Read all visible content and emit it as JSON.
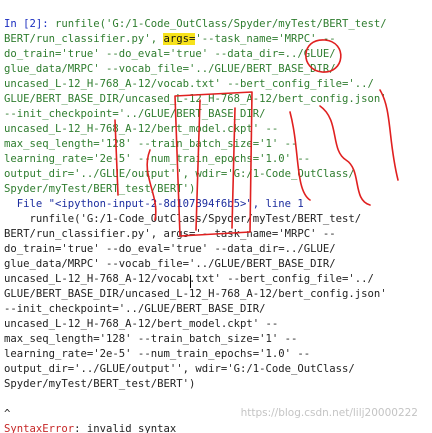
{
  "console": {
    "prompt": "In [2]:",
    "command_lines": [
      " runfile('G:/1-Code_OutClass/Spyder/myTest/BERT_test/",
      "BERT/run_classifier.py', ",
      "args=",
      "'--task_name='MRPC' --",
      "do_train='true' --do_eval='true' --data_dir=../GLUE/",
      "glue_data/MRPC' --vocab_file='../GLUE/BERT_BASE_DIR/",
      "uncased_L-12_H-768_A-12/vocab.txt' --bert_config_file='../",
      "GLUE/BERT_BASE_DIR/uncased_L-12_H-768_A-12/bert_config.json'",
      "--init_checkpoint='../GLUE/BERT_BASE_DIR/",
      "uncased_L-12_H-768_A-12/bert_model.ckpt' --",
      "max_seq_length='128' --train_batch_size='1' --",
      "learning_rate='2e-5' --num_train_epochs='1.0' --",
      "output_dir='../GLUE/output'', wdir='G:/1-Code_OutClass/",
      "Spyder/myTest/BERT_test/BERT')"
    ],
    "traceback_file": "  File \"<ipython-input-2-8d107894f6b5>\", line 1",
    "traceback_lines": [
      "    runfile('G:/1-Code_OutClass/Spyder/myTest/BERT_test/",
      "BERT/run_classifier.py', args='--task_name='MRPC' --",
      "do_train='true' --do_eval='true' --data_dir=../GLUE/",
      "glue_data/MRPC' --vocab_file='../GLUE/BERT_BASE_DIR/",
      "uncased_L-12_H-768_A-12/vocab.txt' --bert_config_file='../",
      "GLUE/BERT_BASE_DIR/uncased_L-12_H-768_A-12/bert_config.json'",
      "--init_checkpoint='../GLUE/BERT_BASE_DIR/",
      "uncased_L-12_H-768_A-12/bert_model.ckpt' --",
      "max_seq_length='128' --train_batch_size='1' --",
      "learning_rate='2e-5' --num_train_epochs='1.0' --",
      "output_dir='../GLUE/output'', wdir='G:/1-Code_OutClass/",
      "Spyder/myTest/BERT_test/BERT')"
    ],
    "error_caret": "^",
    "error_name": "SyntaxError",
    "error_message": ": invalid syntax"
  },
  "watermark": "https://blog.csdn.net/lilj20000222",
  "colors": {
    "prompt": "#1b2ec0",
    "string": "#2f7d2f",
    "highlight": "#f7e21b",
    "annotation": "#e02020",
    "error": "#c62828"
  }
}
